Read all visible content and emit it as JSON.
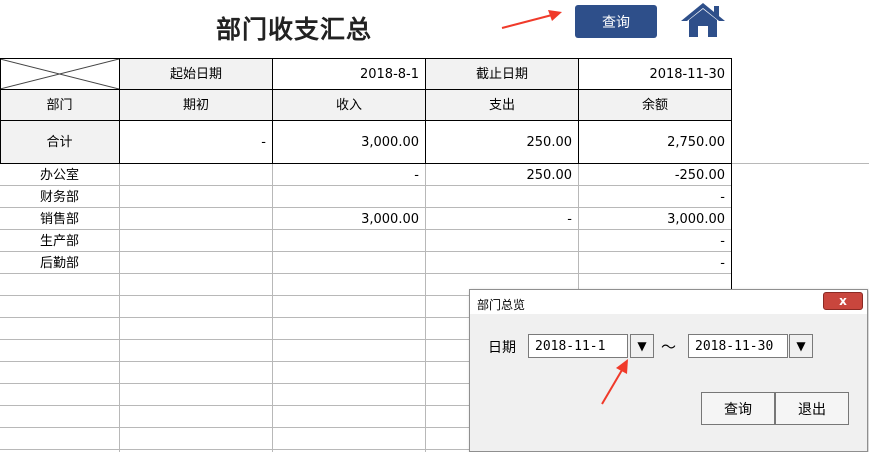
{
  "header": {
    "title": "部门收支汇总",
    "query_label": "查询",
    "home_icon": "home-icon",
    "brand_color": "#2e4f8a"
  },
  "summary": {
    "start_label": "起始日期",
    "start_value": "2018-8-1",
    "end_label": "截止日期",
    "end_value": "2018-11-30"
  },
  "columns": [
    "部门",
    "期初",
    "收入",
    "支出",
    "余额"
  ],
  "total": {
    "label": "合计",
    "opening": "-",
    "income": "3,000.00",
    "expense": "250.00",
    "balance": "2,750.00"
  },
  "rows": [
    {
      "dept": "办公室",
      "opening": "",
      "income": "-",
      "expense": "250.00",
      "balance": "-250.00"
    },
    {
      "dept": "财务部",
      "opening": "",
      "income": "",
      "expense": "",
      "balance": "-"
    },
    {
      "dept": "销售部",
      "opening": "",
      "income": "3,000.00",
      "expense": "-",
      "balance": "3,000.00"
    },
    {
      "dept": "生产部",
      "opening": "",
      "income": "",
      "expense": "",
      "balance": "-"
    },
    {
      "dept": "后勤部",
      "opening": "",
      "income": "",
      "expense": "",
      "balance": "-"
    }
  ],
  "dialog": {
    "title": "部门总览",
    "close_glyph": "x",
    "date_label": "日期",
    "start_date": "2018-11-1",
    "separator": "～",
    "end_date": "2018-11-30",
    "dropdown_glyph": "▼",
    "query_label": "查询",
    "exit_label": "退出"
  }
}
